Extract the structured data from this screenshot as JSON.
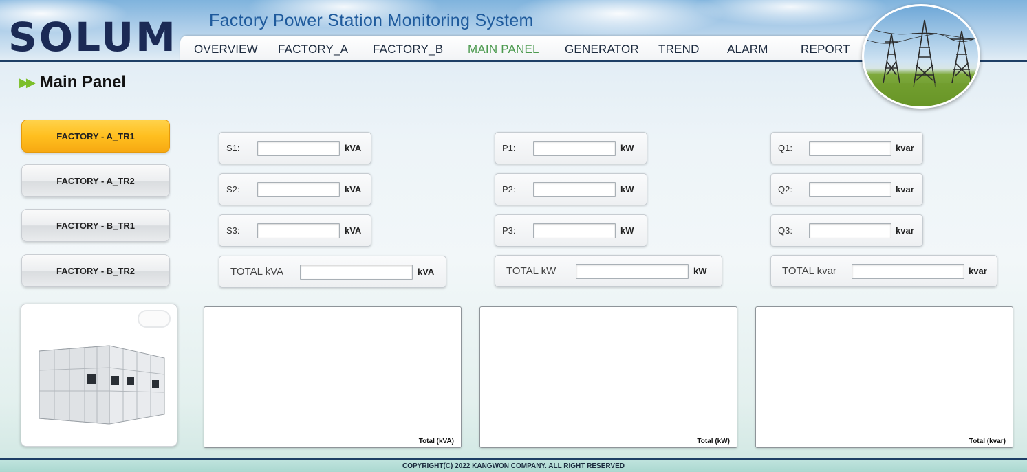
{
  "header": {
    "logo": "SOLUM",
    "title": "Factory Power Station Monitoring System"
  },
  "nav": {
    "items": [
      {
        "label": "OVERVIEW"
      },
      {
        "label": "FACTORY_A"
      },
      {
        "label": "FACTORY_B"
      },
      {
        "label": "MAIN PANEL",
        "active": true
      },
      {
        "label": "GENERATOR"
      },
      {
        "label": "TREND"
      },
      {
        "label": "ALARM"
      },
      {
        "label": "REPORT"
      }
    ],
    "active_color": "#4c9a4f"
  },
  "page": {
    "heading": "Main Panel",
    "heading_icon": "double-arrow-icon"
  },
  "transformers": [
    {
      "label": "FACTORY - A_TR1",
      "active": true
    },
    {
      "label": "FACTORY - A_TR2"
    },
    {
      "label": "FACTORY - B_TR1"
    },
    {
      "label": "FACTORY - B_TR2"
    }
  ],
  "metrics": {
    "apparent": {
      "rows": [
        {
          "label": "S1:",
          "value": "",
          "unit": "kVA"
        },
        {
          "label": "S2:",
          "value": "",
          "unit": "kVA"
        },
        {
          "label": "S3:",
          "value": "",
          "unit": "kVA"
        }
      ],
      "total": {
        "label": "TOTAL kVA",
        "value": "",
        "unit": "kVA"
      }
    },
    "active": {
      "rows": [
        {
          "label": "P1:",
          "value": "",
          "unit": "kW"
        },
        {
          "label": "P2:",
          "value": "",
          "unit": "kW"
        },
        {
          "label": "P3:",
          "value": "",
          "unit": "kW"
        }
      ],
      "total": {
        "label": "TOTAL kW",
        "value": "",
        "unit": "kW"
      }
    },
    "reactive": {
      "rows": [
        {
          "label": "Q1:",
          "value": "",
          "unit": "kvar"
        },
        {
          "label": "Q2:",
          "value": "",
          "unit": "kvar"
        },
        {
          "label": "Q3:",
          "value": "",
          "unit": "kvar"
        }
      ],
      "total": {
        "label": "TOTAL kvar",
        "value": "",
        "unit": "kvar"
      }
    }
  },
  "charts": [
    {
      "caption": "Total (kVA)"
    },
    {
      "caption": "Total (kW)"
    },
    {
      "caption": "Total (kvar)"
    }
  ],
  "footer": {
    "copyright": "COPYRIGHT(C) 2022 KANGWON COMPANY. ALL RIGHT RESERVED"
  },
  "colors": {
    "brand_navy": "#1b2a55",
    "title_blue": "#1e5a9c",
    "active_button": "#ffbf1f",
    "rule": "#1e3f66"
  }
}
